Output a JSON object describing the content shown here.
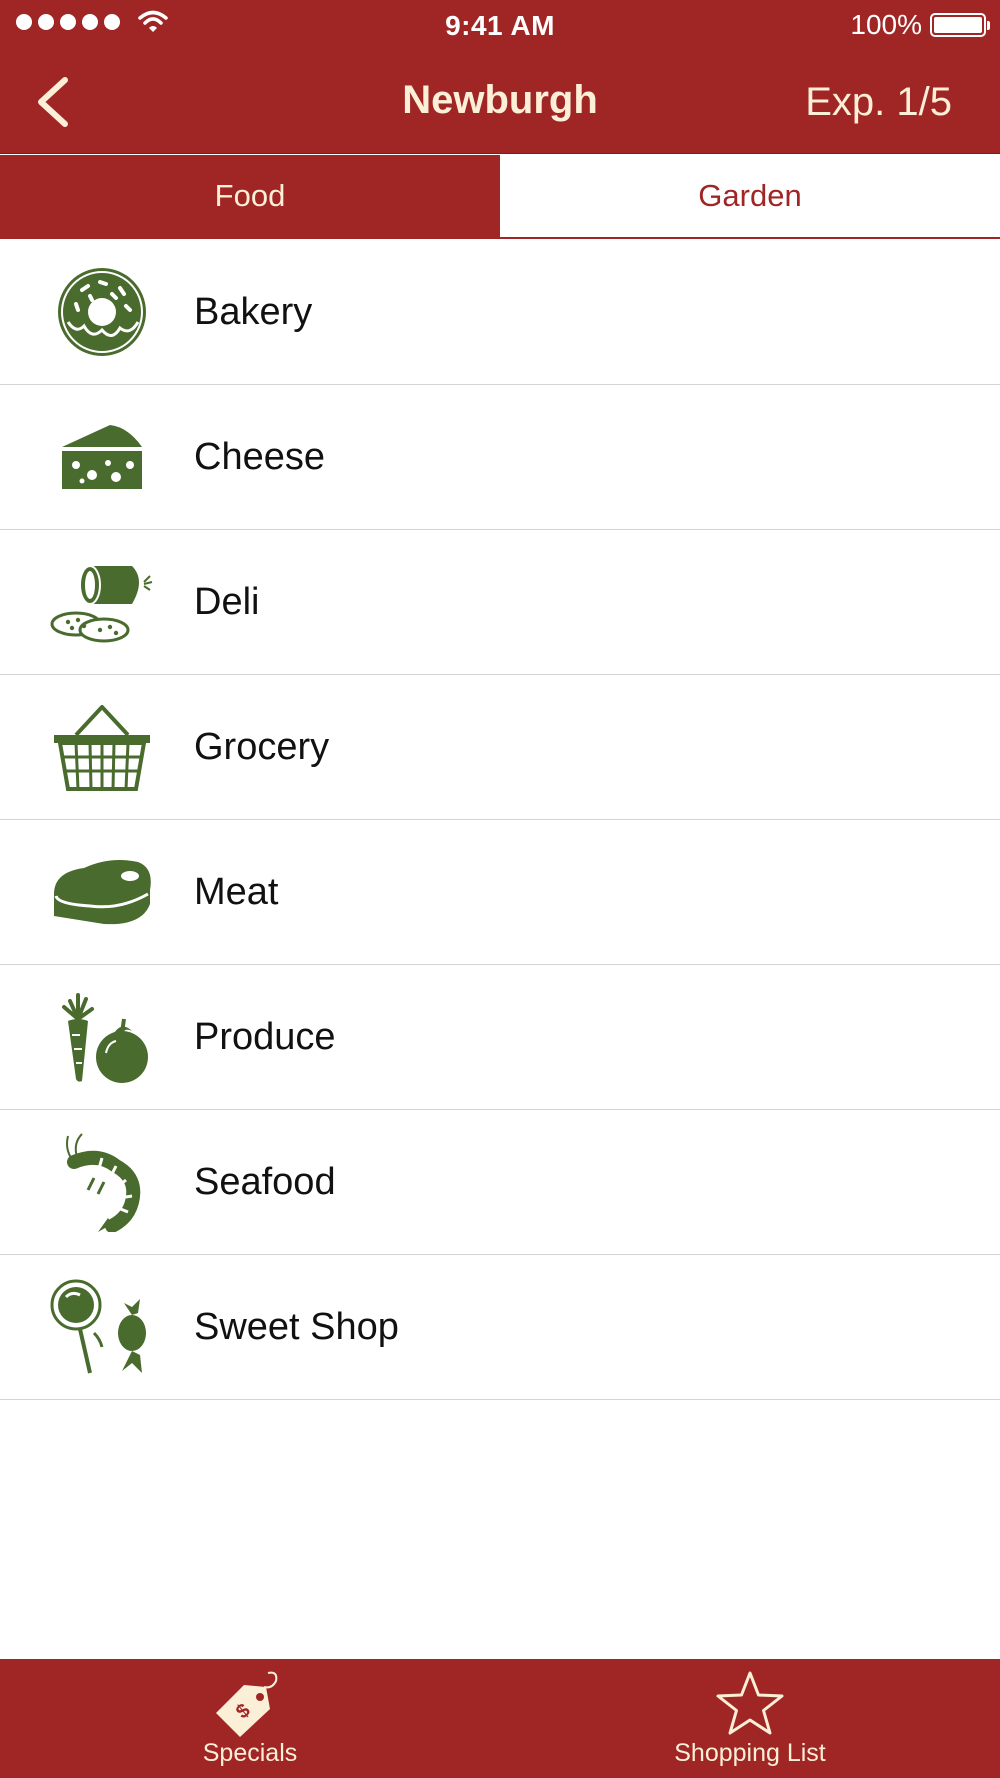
{
  "status_bar": {
    "time": "9:41 AM",
    "battery": "100%"
  },
  "nav": {
    "title": "Newburgh",
    "right_label": "Exp. 1/5"
  },
  "tabs": [
    {
      "label": "Food",
      "selected": false
    },
    {
      "label": "Garden",
      "selected": true
    }
  ],
  "categories": [
    {
      "label": "Bakery",
      "icon": "donut-icon"
    },
    {
      "label": "Cheese",
      "icon": "cheese-icon"
    },
    {
      "label": "Deli",
      "icon": "salami-icon"
    },
    {
      "label": "Grocery",
      "icon": "basket-icon"
    },
    {
      "label": "Meat",
      "icon": "steak-icon"
    },
    {
      "label": "Produce",
      "icon": "carrot-tomato-icon"
    },
    {
      "label": "Seafood",
      "icon": "shrimp-icon"
    },
    {
      "label": "Sweet Shop",
      "icon": "lollipop-candy-icon"
    }
  ],
  "tab_bar": [
    {
      "label": "Specials",
      "icon": "price-tag-icon"
    },
    {
      "label": "Shopping List",
      "icon": "star-icon"
    }
  ],
  "colors": {
    "brand_red": "#a02626",
    "icon_green": "#4a6b2e",
    "header_text": "#fbefd7"
  }
}
